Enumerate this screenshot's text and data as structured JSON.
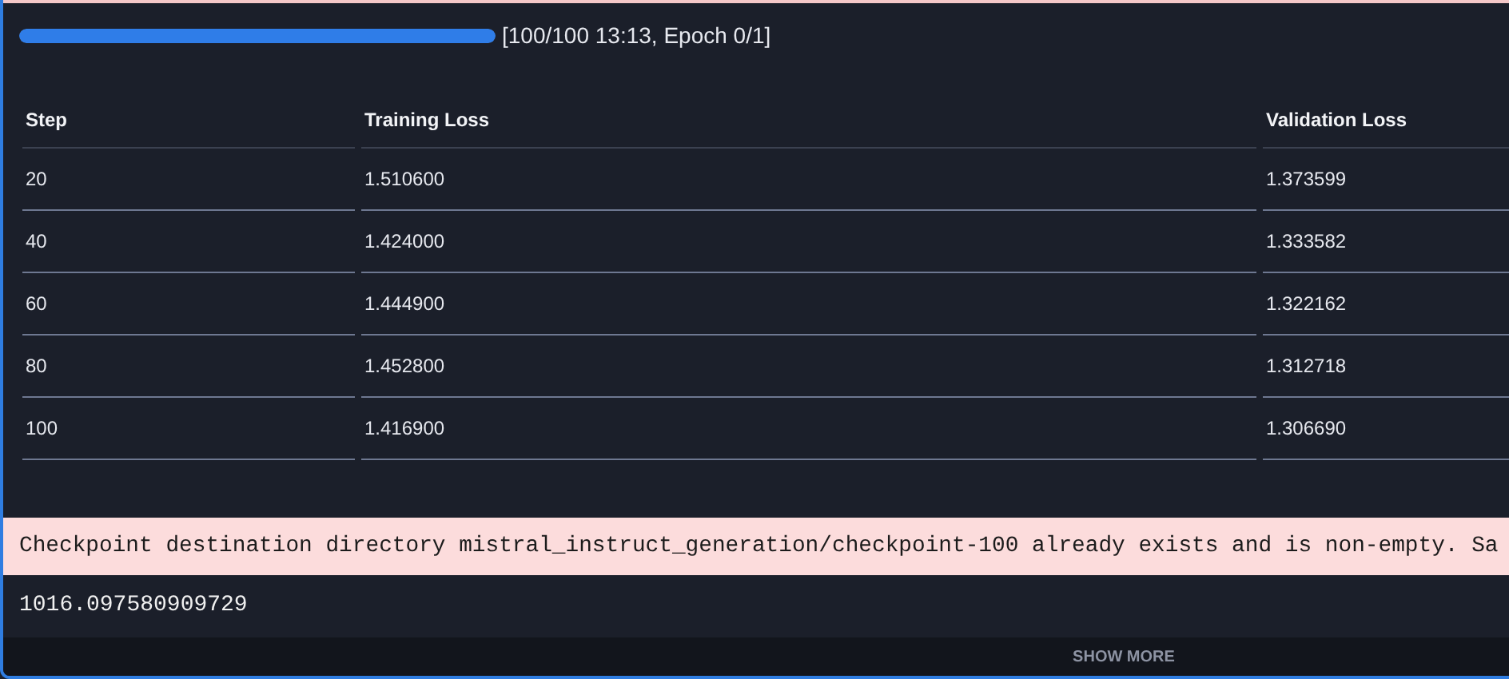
{
  "progress": {
    "level": 1,
    "label": "[100/100 13:13, Epoch 0/1]"
  },
  "table": {
    "columns": [
      "Step",
      "Training Loss",
      "Validation Loss"
    ],
    "rows": [
      [
        "20",
        "1.510600",
        "1.373599"
      ],
      [
        "40",
        "1.424000",
        "1.333582"
      ],
      [
        "60",
        "1.444900",
        "1.322162"
      ],
      [
        "80",
        "1.452800",
        "1.312718"
      ],
      [
        "100",
        "1.416900",
        "1.306690"
      ]
    ]
  },
  "warning": "Checkpoint destination directory mistral_instruct_generation/checkpoint-100 already exists and is non-empty. Sa",
  "output": "1016.097580909729",
  "show_more": "SHOW MORE"
}
